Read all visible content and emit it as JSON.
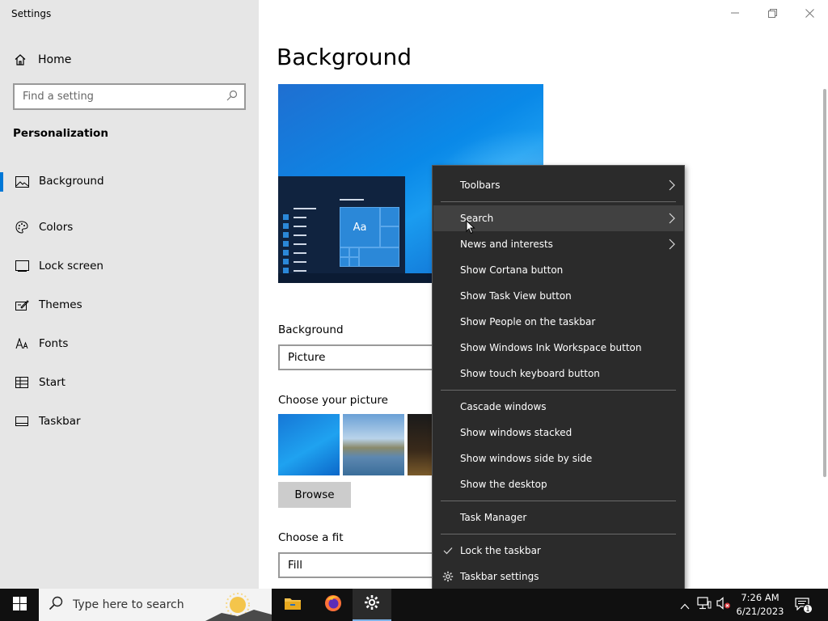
{
  "window": {
    "title": "Settings",
    "controls": {
      "minimize": "minimize",
      "maximize": "restore",
      "close": "close"
    }
  },
  "sidebar": {
    "home_label": "Home",
    "search_placeholder": "Find a setting",
    "section_title": "Personalization",
    "items": [
      {
        "label": "Background",
        "icon": "picture-icon",
        "active": true
      },
      {
        "label": "Colors",
        "icon": "palette-icon",
        "active": false
      },
      {
        "label": "Lock screen",
        "icon": "lock-screen-icon",
        "active": false
      },
      {
        "label": "Themes",
        "icon": "themes-icon",
        "active": false
      },
      {
        "label": "Fonts",
        "icon": "fonts-icon",
        "active": false
      },
      {
        "label": "Start",
        "icon": "start-icon",
        "active": false
      },
      {
        "label": "Taskbar",
        "icon": "taskbar-icon",
        "active": false
      }
    ]
  },
  "main": {
    "title": "Background",
    "preview_sample_text": "Aa",
    "background_label": "Background",
    "background_value": "Picture",
    "choose_picture_label": "Choose your picture",
    "browse_label": "Browse",
    "choose_fit_label": "Choose a fit",
    "fit_value": "Fill"
  },
  "context_menu": {
    "items": [
      {
        "label": "Toolbars",
        "submenu": true
      },
      {
        "label": "Search",
        "submenu": true,
        "hover": true
      },
      {
        "label": "News and interests",
        "submenu": true
      },
      {
        "label": "Show Cortana button"
      },
      {
        "label": "Show Task View button"
      },
      {
        "label": "Show People on the taskbar"
      },
      {
        "label": "Show Windows Ink Workspace button"
      },
      {
        "label": "Show touch keyboard button"
      },
      {
        "label": "Cascade windows"
      },
      {
        "label": "Show windows stacked"
      },
      {
        "label": "Show windows side by side"
      },
      {
        "label": "Show the desktop"
      },
      {
        "label": "Task Manager"
      },
      {
        "label": "Lock the taskbar",
        "checked": true
      },
      {
        "label": "Taskbar settings",
        "icon": "gear-icon"
      }
    ]
  },
  "taskbar": {
    "search_placeholder": "Type here to search",
    "time": "7:26 AM",
    "date": "6/21/2023",
    "notification_count": "1",
    "colors": {
      "background": "#101010",
      "accent": "#0078d7"
    }
  }
}
